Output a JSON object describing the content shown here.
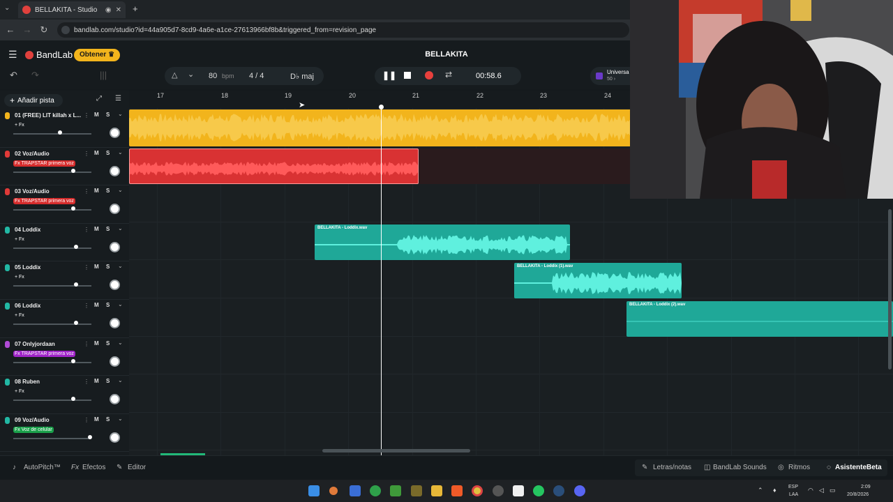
{
  "browser": {
    "tab_title": "BELLAKITA - Studio",
    "url": "bandlab.com/studio?id=44a905d7-8cd9-4a6e-a1ce-27613966bf8b&triggered_from=revision_page",
    "new_tab": "+"
  },
  "app": {
    "logo": "BandLab",
    "get_button": "Obtener",
    "project_title": "BELLAKITA"
  },
  "transport": {
    "bpm": "80",
    "bpm_unit": "bpm",
    "time_signature": "4 / 4",
    "key": "D♭ maj",
    "time": "00:58.6",
    "sidebar_label": "Universa",
    "sidebar_sub": "50 ›"
  },
  "tracks_panel": {
    "add_track": "Añadir pista"
  },
  "ruler": [
    "17",
    "18",
    "19",
    "20",
    "21",
    "22",
    "23",
    "24"
  ],
  "tracks": [
    {
      "name": "01  (FREE) LIT killah x L...",
      "fx": "+ Fx",
      "fx_style": "plain",
      "mute": "M",
      "solo": "S",
      "volume": 0.6,
      "color": "#f2b41c"
    },
    {
      "name": "02  Voz/Audio",
      "fx": "Fx  TRAPSTAR primera voz",
      "fx_style": "red",
      "mute": "M",
      "solo": "S",
      "volume": 0.77,
      "color": "#e03a38"
    },
    {
      "name": "03  Voz/Audio",
      "fx": "Fx  TRAPSTAR primera voz",
      "fx_style": "red",
      "mute": "M",
      "solo": "S",
      "volume": 0.77,
      "color": "#e03a38"
    },
    {
      "name": "04  Loddix",
      "fx": "+ Fx",
      "fx_style": "plain",
      "mute": "M",
      "solo": "S",
      "volume": 0.8,
      "color": "#22b8a4"
    },
    {
      "name": "05  Loddix",
      "fx": "+ Fx",
      "fx_style": "plain",
      "mute": "M",
      "solo": "S",
      "volume": 0.8,
      "color": "#22b8a4"
    },
    {
      "name": "06  Loddix",
      "fx": "+ Fx",
      "fx_style": "plain",
      "mute": "M",
      "solo": "S",
      "volume": 0.8,
      "color": "#22b8a4"
    },
    {
      "name": "07  Onlyjordaan",
      "fx": "Fx  TRAPSTAR primera voz",
      "fx_style": "purple",
      "mute": "M",
      "solo": "S",
      "volume": 0.77,
      "color": "#b04bd6"
    },
    {
      "name": "08  Ruben",
      "fx": "+ Fx",
      "fx_style": "plain",
      "mute": "M",
      "solo": "S",
      "volume": 0.77,
      "color": "#22b8a4"
    },
    {
      "name": "09  Voz/Audio",
      "fx": "Fx  Voz de celular",
      "fx_style": "green",
      "mute": "M",
      "solo": "S",
      "volume": 0.98,
      "color": "#22b8a4"
    }
  ],
  "regions": {
    "r4": "BELLAKITA - Loddix.wav",
    "r5": "BELLAKITA - Loddix (1).wav",
    "r6": "BELLAKITA - Loddix (2).wav"
  },
  "bottom_bar": {
    "autopitch": "AutoPitch™",
    "effects": "Efectos",
    "editor": "Editor",
    "lyrics": "Letras/notas",
    "sounds": "BandLab Sounds",
    "rhythms": "Ritmos",
    "assistant": "Asistente",
    "beta": "Beta"
  },
  "taskbar": {
    "lang": "ESP",
    "lang_sub": "LAA",
    "time": "2:09",
    "date": "20/8/2026"
  },
  "colors": {
    "beat": "#f2b41c",
    "vocal": "#e03a38",
    "loddix": "#1fa898",
    "accent": "#f2b41c"
  }
}
